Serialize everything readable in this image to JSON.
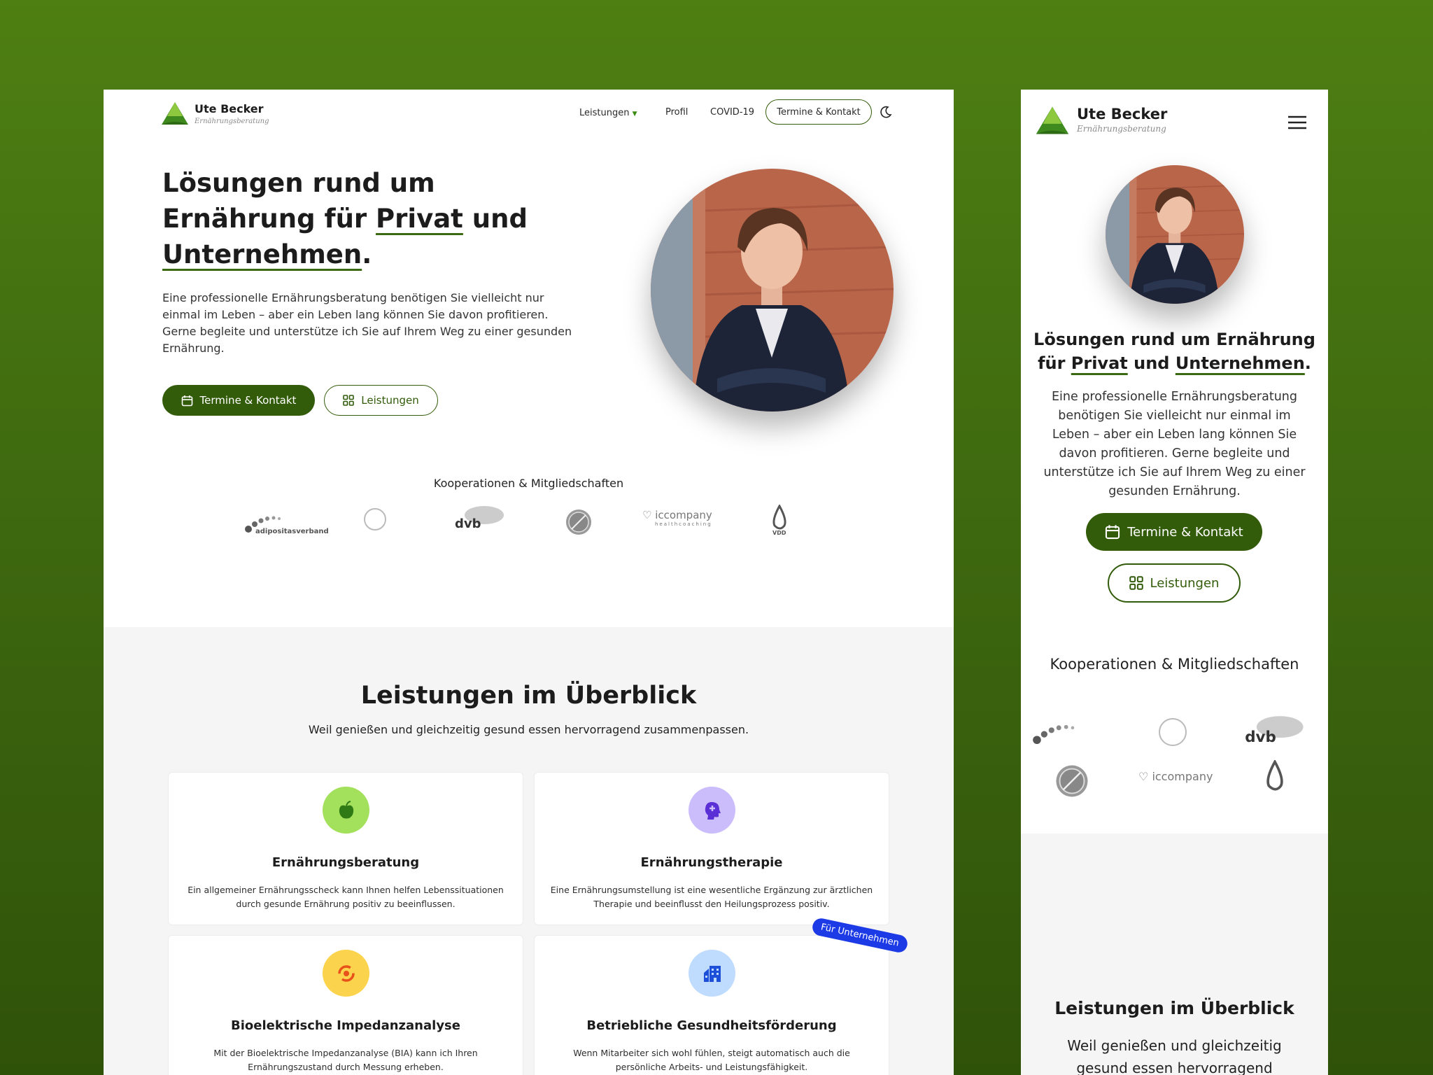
{
  "brand": {
    "name": "Ute Becker",
    "tagline": "Ernährungsberatung"
  },
  "nav": {
    "services": "Leistungen",
    "profile": "Profil",
    "covid": "COVID-19",
    "contact": "Termine & Kontakt"
  },
  "hero": {
    "title_a": "Lösungen rund um Ernährung für ",
    "title_privat": "Privat",
    "title_und": " und ",
    "title_unternehmen": "Unternehmen",
    "title_dot": ".",
    "text": "Eine professionelle Ernährungsberatung benötigen Sie vielleicht nur einmal im Leben – aber ein Leben lang können Sie davon profitieren. Gerne begleite und unterstütze ich Sie auf Ihrem Weg zu einer gesunden Ernährung.",
    "btn_primary": "Termine & Kontakt",
    "btn_secondary": "Leistungen"
  },
  "partners": {
    "title": "Kooperationen & Mitgliedschaften",
    "logos": [
      "adipositasverband",
      "iccompany",
      "healthcoaching",
      "VDD",
      "Deutscher Allergie- und Asthmabund"
    ]
  },
  "services": {
    "title": "Leistungen im Überblick",
    "subtitle": "Weil genießen und gleichzeitig gesund essen hervorragend zusammenpassen.",
    "badge": "Für Unternehmen",
    "items": [
      {
        "title": "Ernährungsberatung",
        "desc": "Ein allgemeiner Ernährungsscheck kann Ihnen helfen Lebenssituationen durch gesunde Ernährung positiv zu beeinflussen.",
        "icon": "apple-icon",
        "color": "#a3e05b"
      },
      {
        "title": "Ernährungstherapie",
        "desc": "Eine Ernährungsumstellung ist eine wesentliche Ergänzung zur ärztlichen Therapie und beeinflusst den Heilungsprozess positiv.",
        "icon": "head-icon",
        "color": "#cbbdfb"
      },
      {
        "title": "Bioelektrische Impedanzanalyse",
        "desc": "Mit der Bioelektrische Impedanzanalyse (BIA) kann ich Ihren Ernährungszustand durch Messung erheben.",
        "icon": "cycle-icon",
        "color": "#fcd34d"
      },
      {
        "title": "Betriebliche Gesundheitsförderung",
        "desc": "Wenn Mitarbeiter sich wohl fühlen, steigt automatisch auch die persönliche Arbeits- und Leistungsfähigkeit.",
        "icon": "building-icon",
        "color": "#bfdbfe"
      }
    ]
  },
  "colors": {
    "brand_green": "#325c0a",
    "badge_blue": "#1c3ae6",
    "background": "#3f6a10"
  }
}
